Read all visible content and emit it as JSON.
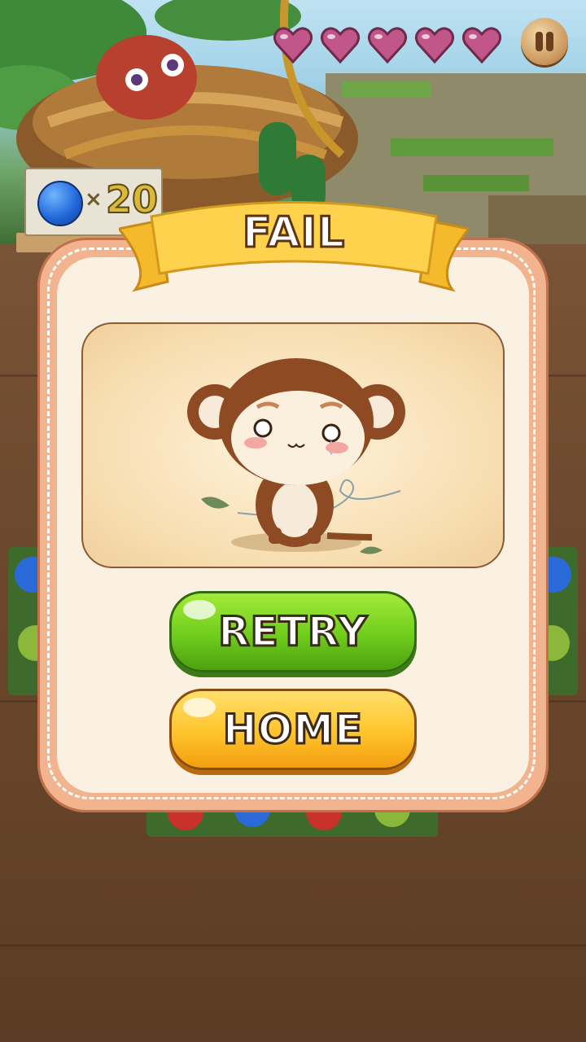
{
  "hud": {
    "lives_filled": 5,
    "lives_total": 5,
    "heart_color": "#c0568a",
    "pause_icon": "pause-icon"
  },
  "goal": {
    "item_icon": "blueberry-icon",
    "multiplier": "×",
    "count": "20"
  },
  "dialog": {
    "title": "FAIL",
    "character": "crying-monkey-illustration",
    "retry_label": "RETRY",
    "home_label": "HOME"
  },
  "colors": {
    "panel_border": "#f1b48e",
    "panel_fill": "#faf1e2",
    "retry_green": "#6fcd1c",
    "home_yellow": "#ffc42b",
    "ribbon_yellow": "#ffd24d"
  }
}
